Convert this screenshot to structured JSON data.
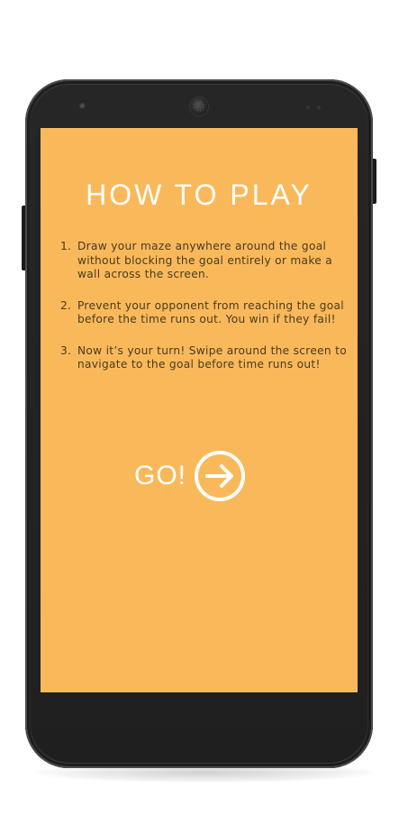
{
  "screen": {
    "background_color": "#f9b95b",
    "title": "HOW TO PLAY",
    "instructions": [
      {
        "number": "1.",
        "text": "Draw your maze anywhere around the goal without blocking the goal entirely or make a wall across the screen."
      },
      {
        "number": "2.",
        "text": "Prevent your opponent from reaching the goal before the time runs out. You win if they fail!"
      },
      {
        "number": "3.",
        "text": "Now it’s your turn! Swipe around the screen to navigate to the goal before time runs out!"
      }
    ],
    "go_button": {
      "label": "GO!",
      "icon": "arrow-right-circle-icon"
    }
  },
  "device": {
    "frame_color": "#262626"
  }
}
